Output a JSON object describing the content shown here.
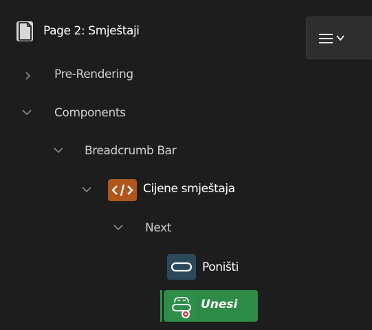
{
  "page": {
    "title": "Page 2: Smještaji"
  },
  "tree": {
    "pre_rendering": "Pre-Rendering",
    "components": "Components",
    "breadcrumb_bar": "Breadcrumb Bar",
    "region": "Cijene smještaja",
    "next": "Next",
    "button_ponisti": "Poništi",
    "button_unesi": "Unesi"
  },
  "icons": {
    "page": "page-icon",
    "menu": "menu-icon",
    "chevron_down": "chevron-down-icon",
    "chevron_right": "chevron-right-icon",
    "code": "code-icon",
    "button": "button-icon",
    "button_with_badge": "button-icon"
  },
  "colors": {
    "background": "#1d1d1d",
    "code_badge": "#b0551c",
    "button_badge": "#2a4a5c",
    "selected": "#2e8b47"
  }
}
